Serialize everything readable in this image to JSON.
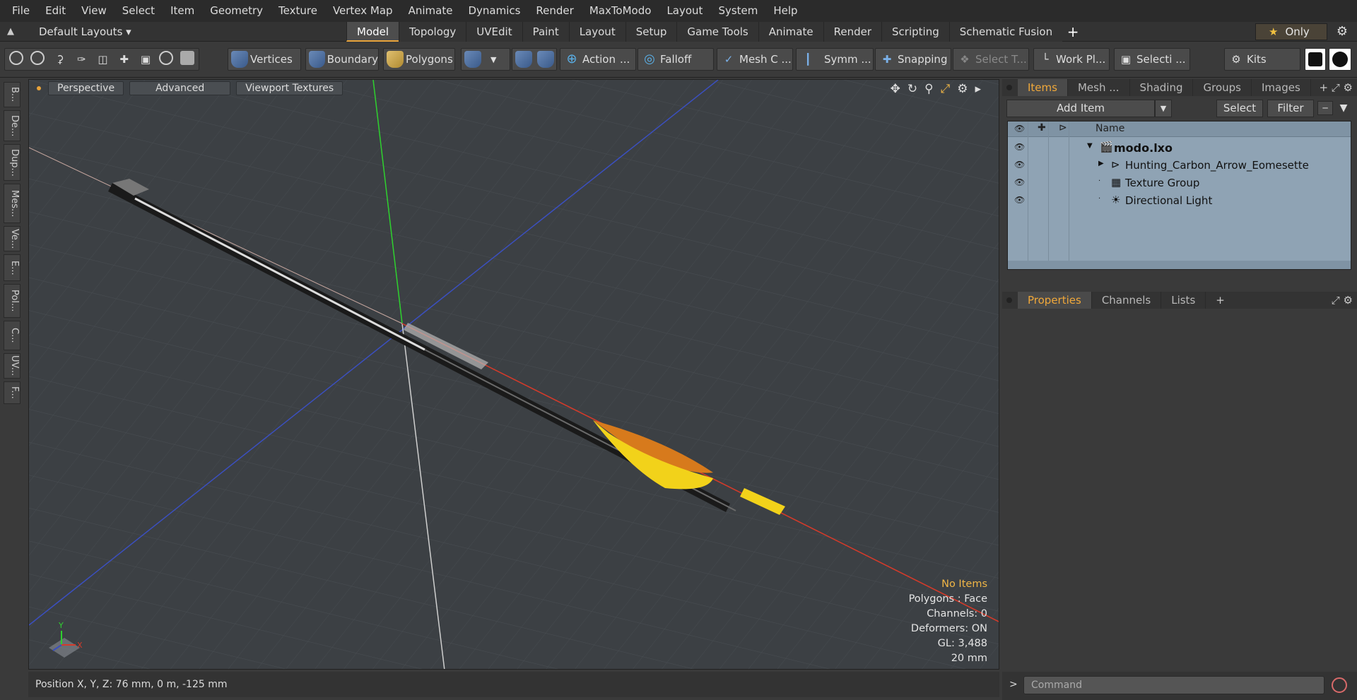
{
  "menu": [
    "File",
    "Edit",
    "View",
    "Select",
    "Item",
    "Geometry",
    "Texture",
    "Vertex Map",
    "Animate",
    "Dynamics",
    "Render",
    "MaxToModo",
    "Layout",
    "System",
    "Help"
  ],
  "layoutbar": {
    "layouts_label": "Default Layouts ▾",
    "tabs": [
      "Model",
      "Topology",
      "UVEdit",
      "Paint",
      "Layout",
      "Setup",
      "Game Tools",
      "Animate",
      "Render",
      "Scripting",
      "Schematic Fusion"
    ],
    "active_tab": "Model",
    "only_label": "Only"
  },
  "toolbar": {
    "vertices": "Vertices",
    "boundary": "Boundary",
    "polygons": "Polygons",
    "action": "Action",
    "falloff": "Falloff",
    "mesh": "Mesh C ...",
    "symm": "Symm ...",
    "snapping": "Snapping",
    "select_t": "Select T...",
    "workpl": "Work Pl...",
    "selecti": "Selecti ...",
    "kits": "Kits"
  },
  "lefttabs": [
    "B...",
    "De...",
    "Dup...",
    "Mes...",
    "Ve...",
    "E...",
    "Pol...",
    "C...",
    "UV...",
    "F..."
  ],
  "viewport": {
    "buttons": [
      "Perspective",
      "Advanced",
      "Viewport Textures"
    ],
    "hud": {
      "selection": "No Items",
      "polygons": "Polygons : Face",
      "channels": "Channels: 0",
      "deformers": "Deformers: ON",
      "gl": "GL: 3,488",
      "scale": "20 mm"
    },
    "axis_y": "Y",
    "axis_x": "X"
  },
  "status": "Position X, Y, Z:   76 mm, 0 m, -125 mm",
  "rightpanel": {
    "tabs": [
      "Items",
      "Mesh ...",
      "Shading",
      "Groups",
      "Images"
    ],
    "active_tab": "Items",
    "add_item": "Add Item",
    "select": "Select",
    "filter": "Filter",
    "col_name": "Name",
    "tree": [
      {
        "label": "modo.lxo",
        "indent": 0,
        "bold": true
      },
      {
        "label": "Hunting_Carbon_Arrow_Eomesette",
        "indent": 1,
        "bold": false
      },
      {
        "label": "Texture Group",
        "indent": 1,
        "bold": false
      },
      {
        "label": "Directional Light",
        "indent": 1,
        "bold": false
      }
    ],
    "prop_tabs": [
      "Properties",
      "Channels",
      "Lists"
    ],
    "active_prop_tab": "Properties",
    "command_placeholder": "Command"
  },
  "colors": {
    "accent": "#e8a33a",
    "viewport_bg": "#3c4044",
    "tree_bg": "#8fa3b4",
    "vane_yellow": "#f2d21a",
    "vane_orange": "#d77a1c"
  }
}
